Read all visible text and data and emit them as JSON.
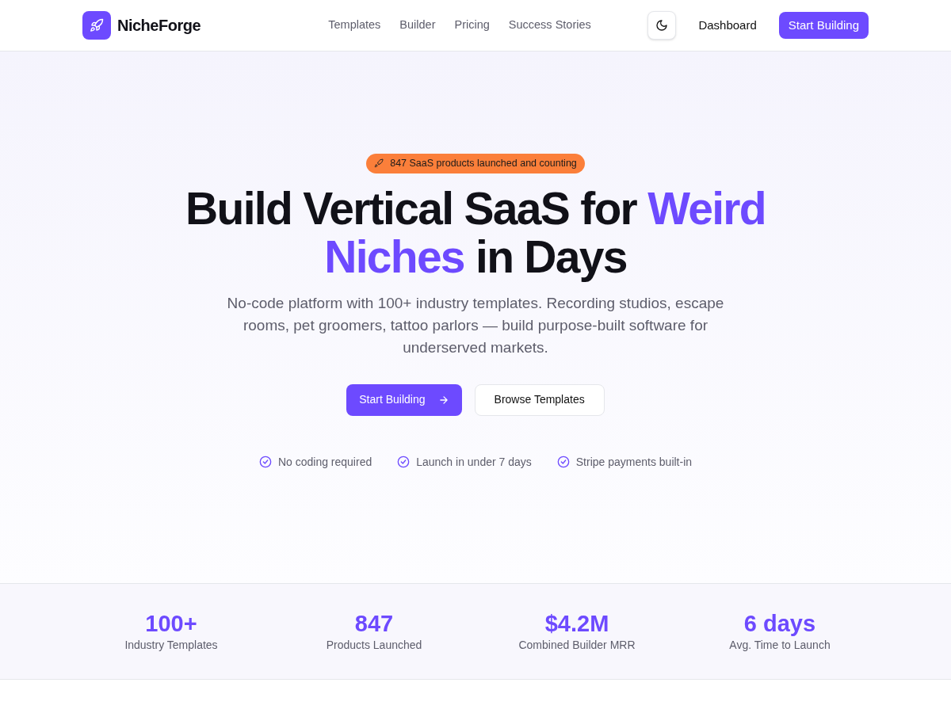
{
  "nav": {
    "brand": "NicheForge",
    "links": [
      "Templates",
      "Builder",
      "Pricing",
      "Success Stories"
    ],
    "dashboard": "Dashboard",
    "cta": "Start Building"
  },
  "hero": {
    "badge": "847 SaaS products launched and counting",
    "headline": [
      {
        "text": "Build Vertical SaaS for ",
        "accent": false
      },
      {
        "text": "Weird Niches",
        "accent": true
      },
      {
        "text": " in Days",
        "accent": false
      }
    ],
    "subtitle": "No-code platform with 100+ industry templates. Recording studios, escape rooms, pet groomers, tattoo parlors — build purpose-built software for underserved markets.",
    "primary_button": "Start Building",
    "secondary_button": "Browse Templates",
    "features": [
      "No coding required",
      "Launch in under 7 days",
      "Stripe payments built-in"
    ]
  },
  "stats": [
    {
      "value": "100+",
      "label": "Industry Templates"
    },
    {
      "value": "847",
      "label": "Products Launched"
    },
    {
      "value": "$4.2M",
      "label": "Combined Builder MRR"
    },
    {
      "value": "6 days",
      "label": "Avg. Time to Launch"
    }
  ]
}
